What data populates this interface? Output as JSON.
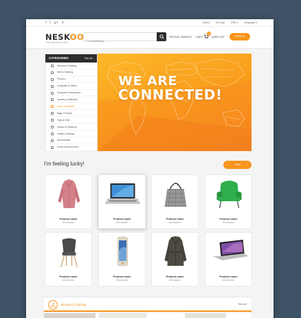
{
  "topbar": {
    "social": [
      "f",
      "t",
      "g+",
      "in"
    ],
    "links": [
      "About",
      "Our App",
      "USD",
      "Language"
    ]
  },
  "header": {
    "logo_prefix": "NESK",
    "logo_suffix": "OO",
    "tagline": "Think about life in color",
    "search_placeholder": "I'm searching...",
    "special_search": "SPECIAL SEARCH",
    "cart_label": "CART",
    "cart_count": "0",
    "wishlist_label": "WISH LIST",
    "signin_label": "SIGN IN"
  },
  "categories": {
    "title": "CATEGORIES",
    "see_all": "See all ›",
    "items": [
      "Women's Clothing",
      "Men's Clothing",
      "Phones",
      "Computer & Office",
      "Consumer Electronics",
      "Jewelry & Watches",
      "Home & Garden",
      "Bags & Shoes",
      "Toys & Kids",
      "Sports & Outdoors",
      "Health & Beauty",
      "Automobiles",
      "Home Improvement"
    ],
    "active_index": 6
  },
  "banner": {
    "line1": "WE ARE",
    "line2": "CONNECTED!"
  },
  "lucky": {
    "title": "I'm feeling lucky!",
    "spin_label": "SPIN"
  },
  "products": [
    {
      "name": "Product name",
      "desc": "Description",
      "icon": "coat-icon"
    },
    {
      "name": "Product name",
      "desc": "Description",
      "icon": "laptop-icon"
    },
    {
      "name": "Product name",
      "desc": "Description",
      "icon": "handbag-icon"
    },
    {
      "name": "Product name",
      "desc": "Description",
      "icon": "armchair-icon"
    },
    {
      "name": "Product name",
      "desc": "Description",
      "icon": "chair-icon"
    },
    {
      "name": "Product name",
      "desc": "Description",
      "icon": "smartphone-icon"
    },
    {
      "name": "Product name",
      "desc": "Description",
      "icon": "trench-coat-icon"
    },
    {
      "name": "Product name",
      "desc": "Description",
      "icon": "ultrabook-icon"
    }
  ],
  "section": {
    "title": "Women's Clothing",
    "see_all": "See all ›"
  },
  "colors": {
    "accent": "#f7941d",
    "dark": "#2d2d2d",
    "background": "#3f5366"
  }
}
